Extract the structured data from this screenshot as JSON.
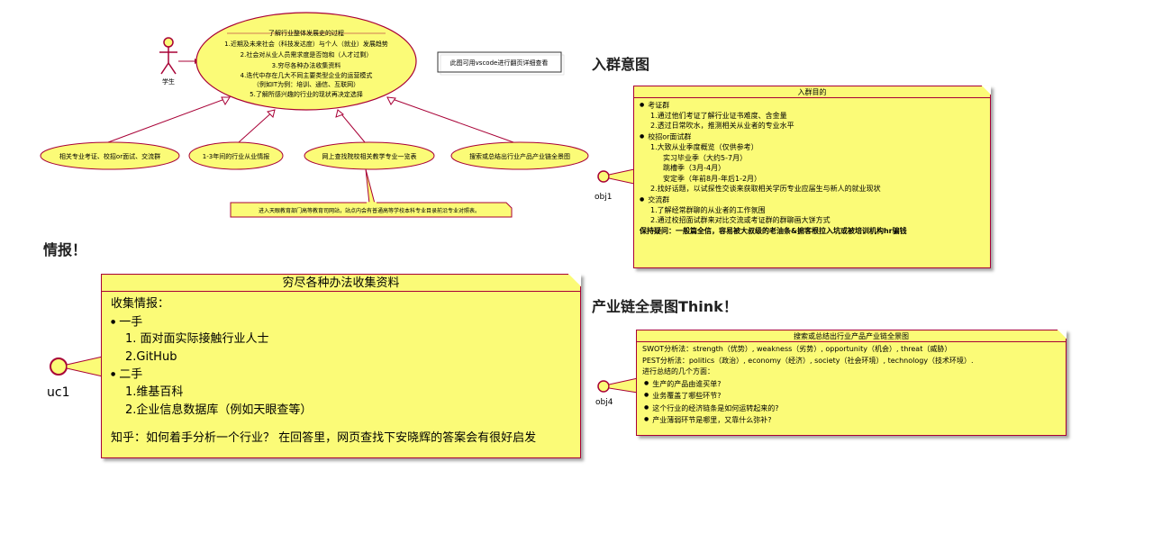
{
  "top_diagram": {
    "actor_label": "学生",
    "center_lines": [
      "了解行业整体发展史的过程",
      "1.近期及未来社会（科技发达度）与个人（就业）发展趋势",
      "2.社会对从业人员需求度是否饱和（人才过剩）",
      "3.穷尽各种办法收集资料",
      "4.迭代中存在几大不同主要类型企业的运营模式",
      "（例如IT为例：培训、通信、互联网）",
      "5.了解所感兴趣的行业的现状再决定选择"
    ],
    "vscode_note": "此图可用vscode进行翻页详细查看",
    "sub_cases": [
      "相关专业考证、校招or面试、交流群",
      "1-3年间的行业从业情报",
      "网上查找院校相关教学专业一览表",
      "搜索或总结出行业产品产业链全景图"
    ],
    "bottom_note": "进入天眼教育部门高等教育司网站，站点内会有普通高等学校本科专业目录前沿专业对照表。"
  },
  "headings": {
    "group": "入群意图",
    "intel": "情报！",
    "industry": "产业链全景图Think！"
  },
  "obj1": {
    "label": "obj1",
    "title": "入群目的",
    "sections": [
      {
        "name": "考证群",
        "items": [
          "1.通过他们考证了解行业证书难度、含金量",
          "2.透过日常吹水，推测相关从业者的专业水平"
        ]
      },
      {
        "name": "校招or面试群",
        "items": [
          "1.大致从业季度概览（仅供参考）",
          "实习毕业季（大约5-7月）",
          "跳槽季（3月-4月）",
          "安定季（年前8月-年后1-2月）",
          "2.找好话题，以试探性交谈来获取相关学历专业应届生与新人的就业现状"
        ]
      },
      {
        "name": "交流群",
        "items": [
          "1.了解经常群聊的从业者的工作氛围",
          "2.通过校招面试群来对比交流或考证群的群聊画大饼方式"
        ]
      }
    ],
    "footer": "保持疑问：一般篇全信，容易被大叔级的老油条&掮客根拉入坑或被培训机构hr骗钱"
  },
  "uc1": {
    "label": "uc1",
    "title": "穷尽各种办法收集资料",
    "intro": "收集情报：",
    "first_hand": "一手",
    "first_items": [
      "1. 面对面实际接触行业人士",
      "2.GitHub"
    ],
    "second_hand": "二手",
    "second_items": [
      "1.维基百科",
      "2.企业信息数据库（例如天眼查等）"
    ],
    "footer": "知乎：如何着手分析一个行业？ 在回答里，网页查找下安晓辉的答案会有很好启发"
  },
  "obj4": {
    "label": "obj4",
    "title": "搜索或总结出行业产品产业链全景图",
    "swot": "SWOT分析法：strength（优势）, weakness（劣势）, opportunity（机会）, threat（威胁）",
    "pest": "PEST分析法：politics（政治）, economy（经济）, society（社会环境）, technology（技术环境）.",
    "aspects_title": "进行总结的几个方面：",
    "aspects": [
      "生产的产品由谁买单?",
      "业务覆盖了哪些环节?",
      "这个行业的经济链条是如何运转起来的?",
      "产业薄弱环节是哪里，又靠什么弥补?"
    ]
  },
  "colors": {
    "note_fill": "#fbfb77",
    "border": "#a80036"
  }
}
